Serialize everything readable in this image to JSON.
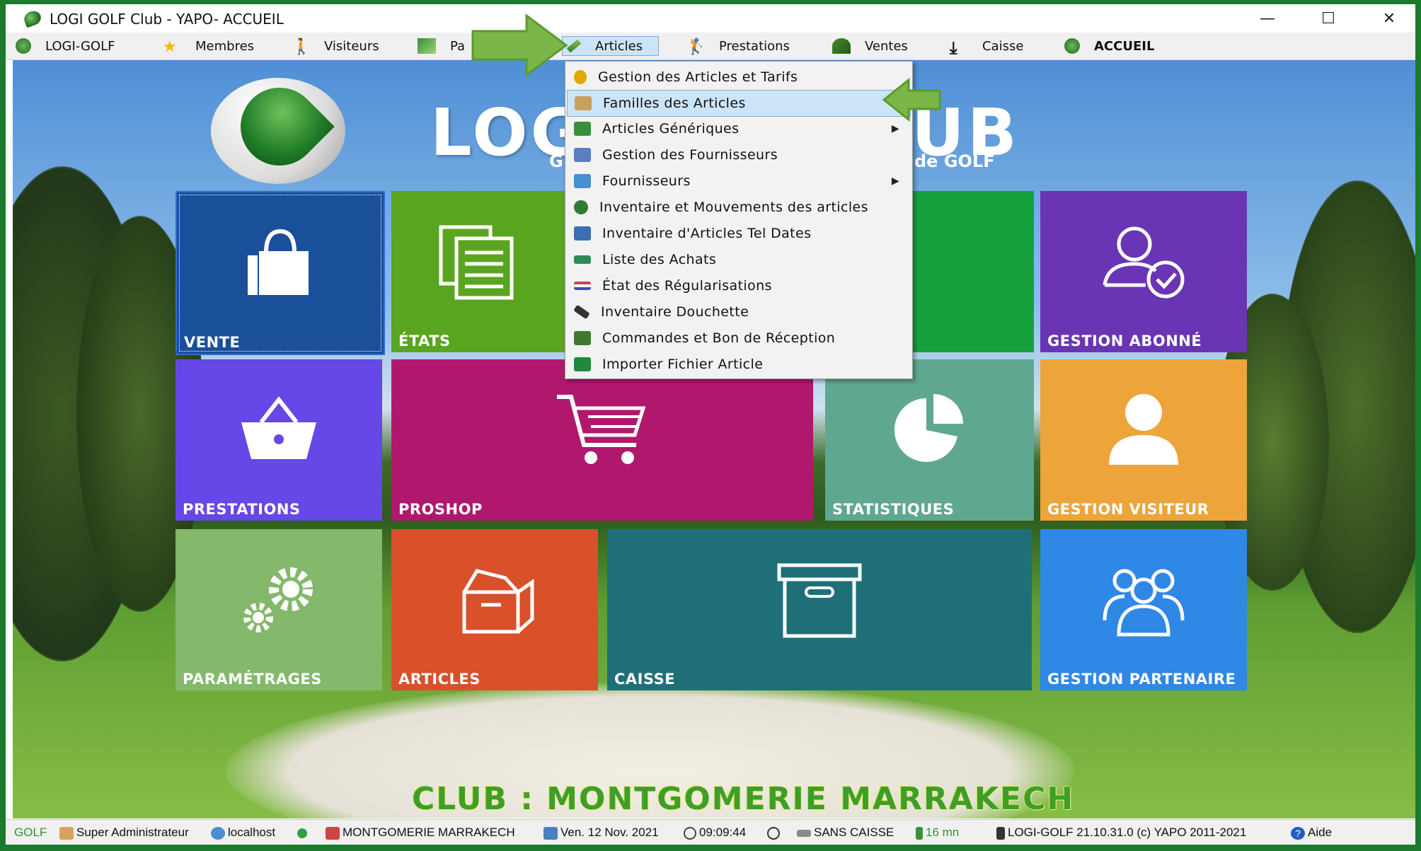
{
  "window": {
    "title": "LOGI GOLF Club - YAPO- ACCUEIL"
  },
  "menubar": {
    "items": [
      {
        "label": "LOGI-GOLF",
        "icon": "golf-ball-icon"
      },
      {
        "label": "Membres",
        "icon": "star-icon"
      },
      {
        "label": "Visiteurs",
        "icon": "walker-icon"
      },
      {
        "label": "Pa",
        "icon": "course-icon"
      },
      {
        "label": "Articles",
        "icon": "pen-icon"
      },
      {
        "label": "Prestations",
        "icon": "golfer-icon"
      },
      {
        "label": "Ventes",
        "icon": "ventes-icon"
      },
      {
        "label": "Caisse",
        "icon": "download-icon"
      },
      {
        "label": "ACCUEIL",
        "icon": "golf-ball-icon"
      }
    ],
    "active": "Articles"
  },
  "header": {
    "title_left": "LOG",
    "title_right": "UB",
    "sub_left": "G",
    "sub_right": "de GOLF"
  },
  "dropdown": {
    "items": [
      {
        "label": "Gestion des Articles et Tarifs",
        "submenu": false,
        "color": "#e0a800"
      },
      {
        "label": "Familles des Articles",
        "submenu": false,
        "color": "#c9a15a",
        "highlighted": true
      },
      {
        "label": "Articles Génériques",
        "submenu": true,
        "color": "#3a8f3a"
      },
      {
        "label": "Gestion des Fournisseurs",
        "submenu": false,
        "color": "#5a7fc0"
      },
      {
        "label": "Fournisseurs",
        "submenu": true,
        "color": "#4a90d0"
      },
      {
        "label": "Inventaire et Mouvements des articles",
        "submenu": false,
        "color": "#2e7d32"
      },
      {
        "label": "Inventaire d'Articles Tel Dates",
        "submenu": false,
        "color": "#3b6fb0"
      },
      {
        "label": "Liste des Achats",
        "submenu": false,
        "color": "#2e8b57"
      },
      {
        "label": "État des Régularisations",
        "submenu": false,
        "color": "#9a8a9a"
      },
      {
        "label": "Inventaire Douchette",
        "submenu": false,
        "color": "#333333"
      },
      {
        "label": "Commandes et Bon de Réception",
        "submenu": false,
        "color": "#3d7a2d"
      },
      {
        "label": "Importer Fichier Article",
        "submenu": false,
        "color": "#1f8a3b"
      }
    ]
  },
  "tiles": [
    {
      "label": "VENTE",
      "icon": "shopping-bag-icon",
      "color": "#1a4f9a"
    },
    {
      "label": "ÉTATS",
      "icon": "documents-icon",
      "color": "#5aa520"
    },
    {
      "label": "",
      "icon": "",
      "color": "#16a03c"
    },
    {
      "label": "GESTION ABONNÉ",
      "icon": "user-check-icon",
      "color": "#6a35b5"
    },
    {
      "label": "PRESTATIONS",
      "icon": "basket-icon",
      "color": "#6647e8"
    },
    {
      "label": "PROSHOP",
      "icon": "cart-icon",
      "color": "#b0186e"
    },
    {
      "label": "STATISTIQUES",
      "icon": "pie-chart-icon",
      "color": "#5fa791"
    },
    {
      "label": "GESTION VISITEUR",
      "icon": "user-icon",
      "color": "#eda43a"
    },
    {
      "label": "PARAMÉTRAGES",
      "icon": "gears-icon",
      "color": "#84b86a"
    },
    {
      "label": "ARTICLES",
      "icon": "box-icon",
      "color": "#d9502a"
    },
    {
      "label": "CAISSE",
      "icon": "archive-icon",
      "color": "#1f6f78"
    },
    {
      "label": "GESTION PARTENAIRE",
      "icon": "group-icon",
      "color": "#2f87e6"
    }
  ],
  "club": {
    "text": "CLUB : MONTGOMERIE MARRAKECH"
  },
  "statusbar": {
    "app": "GOLF",
    "user": "Super Administrateur",
    "host": "localhost",
    "club": "MONTGOMERIE MARRAKECH",
    "date": "Ven. 12 Nov. 2021",
    "time": "09:09:44",
    "caisse": "SANS CAISSE",
    "duration": "16 mn",
    "version": "LOGI-GOLF 21.10.31.0 (c) YAPO 2011-2021",
    "help": "Aide"
  },
  "colors": {
    "accent_green": "#7ab648",
    "highlight": "#cce4f7"
  }
}
